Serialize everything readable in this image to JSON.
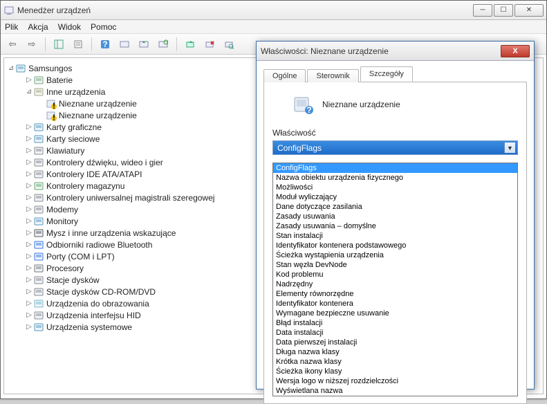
{
  "window": {
    "title": "Menedżer urządzeń",
    "menus": [
      "Plik",
      "Akcja",
      "Widok",
      "Pomoc"
    ]
  },
  "tree": {
    "root": "Samsungos",
    "items": [
      {
        "label": "Baterie",
        "depth": 1,
        "twisty": ">",
        "icon": "battery"
      },
      {
        "label": "Inne urządzenia",
        "depth": 1,
        "twisty": "v",
        "icon": "other"
      },
      {
        "label": "Nieznane urządzenie",
        "depth": 2,
        "twisty": "",
        "icon": "warn"
      },
      {
        "label": "Nieznane urządzenie",
        "depth": 2,
        "twisty": "",
        "icon": "warn"
      },
      {
        "label": "Karty graficzne",
        "depth": 1,
        "twisty": ">",
        "icon": "display"
      },
      {
        "label": "Karty sieciowe",
        "depth": 1,
        "twisty": ">",
        "icon": "network"
      },
      {
        "label": "Klawiatury",
        "depth": 1,
        "twisty": ">",
        "icon": "keyboard"
      },
      {
        "label": "Kontrolery dźwięku, wideo i gier",
        "depth": 1,
        "twisty": ">",
        "icon": "sound"
      },
      {
        "label": "Kontrolery IDE ATA/ATAPI",
        "depth": 1,
        "twisty": ">",
        "icon": "ide"
      },
      {
        "label": "Kontrolery magazynu",
        "depth": 1,
        "twisty": ">",
        "icon": "storage"
      },
      {
        "label": "Kontrolery uniwersalnej magistrali szeregowej",
        "depth": 1,
        "twisty": ">",
        "icon": "usb"
      },
      {
        "label": "Modemy",
        "depth": 1,
        "twisty": ">",
        "icon": "modem"
      },
      {
        "label": "Monitory",
        "depth": 1,
        "twisty": ">",
        "icon": "monitor"
      },
      {
        "label": "Mysz i inne urządzenia wskazujące",
        "depth": 1,
        "twisty": ">",
        "icon": "mouse"
      },
      {
        "label": "Odbiorniki radiowe Bluetooth",
        "depth": 1,
        "twisty": ">",
        "icon": "bt"
      },
      {
        "label": "Porty (COM i LPT)",
        "depth": 1,
        "twisty": ">",
        "icon": "port"
      },
      {
        "label": "Procesory",
        "depth": 1,
        "twisty": ">",
        "icon": "cpu"
      },
      {
        "label": "Stacje dysków",
        "depth": 1,
        "twisty": ">",
        "icon": "disk"
      },
      {
        "label": "Stacje dysków CD-ROM/DVD",
        "depth": 1,
        "twisty": ">",
        "icon": "cd"
      },
      {
        "label": "Urządzenia do obrazowania",
        "depth": 1,
        "twisty": ">",
        "icon": "image"
      },
      {
        "label": "Urządzenia interfejsu HID",
        "depth": 1,
        "twisty": ">",
        "icon": "hid"
      },
      {
        "label": "Urządzenia systemowe",
        "depth": 1,
        "twisty": ">",
        "icon": "system"
      }
    ]
  },
  "dialog": {
    "title": "Właściwości: Nieznane urządzenie",
    "tabs": [
      "Ogólne",
      "Sterownik",
      "Szczegóły"
    ],
    "active_tab": 2,
    "device_name": "Nieznane urządzenie",
    "property_label": "Właściwość",
    "combo_value": "ConfigFlags",
    "dropdown": [
      "ConfigFlags",
      "Nazwa obiektu urządzenia fizycznego",
      "Możliwości",
      "Moduł wyliczający",
      "Dane dotyczące zasilania",
      "Zasady usuwania",
      "Zasady usuwania – domyślne",
      "Stan instalacji",
      "Identyfikator kontenera podstawowego",
      "Ścieżka wystąpienia urządzenia",
      "Stan węzła DevNode",
      "Kod problemu",
      "Nadrzędny",
      "Elementy równorzędne",
      "Identyfikator kontenera",
      "Wymagane bezpieczne usuwanie",
      "Błąd instalacji",
      "Data instalacji",
      "Data pierwszej instalacji",
      "Długa nazwa klasy",
      "Krótka nazwa klasy",
      "Ścieżka ikony klasy",
      "Wersja logo w niższej rozdzielczości",
      "Wyświetlana nazwa"
    ],
    "selected_index": 0
  }
}
